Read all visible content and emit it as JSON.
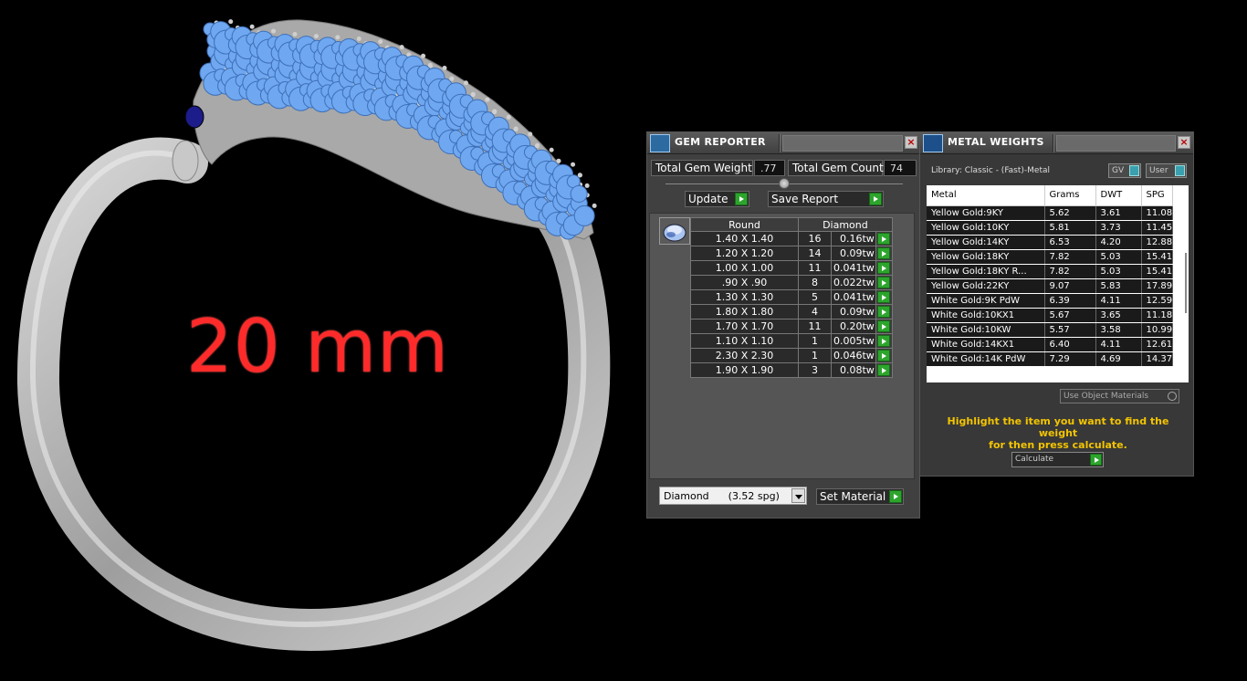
{
  "viewport": {
    "dimension_label": "20 mm",
    "colors": {
      "background": "#000000",
      "ring_metal": "#a8a8a8",
      "gems": "#6fa8f0",
      "dimension_text": "#ff2b2b"
    }
  },
  "gem_reporter": {
    "title": "GEM REPORTER",
    "total_gem_weight_label": "Total Gem Weight",
    "total_gem_weight_value": ".77",
    "total_gem_count_label": "Total Gem Count",
    "total_gem_count_value": "74",
    "update_label": "Update",
    "save_report_label": "Save Report",
    "table": {
      "shape_header": "Round",
      "material_header": "Diamond",
      "rows": [
        {
          "size": "1.40 X 1.40",
          "count": "16",
          "tw": "0.16tw"
        },
        {
          "size": "1.20 X 1.20",
          "count": "14",
          "tw": "0.09tw"
        },
        {
          "size": "1.00 X 1.00",
          "count": "11",
          "tw": "0.041tw"
        },
        {
          "size": ".90 X .90",
          "count": "8",
          "tw": "0.022tw"
        },
        {
          "size": "1.30 X 1.30",
          "count": "5",
          "tw": "0.041tw"
        },
        {
          "size": "1.80 X 1.80",
          "count": "4",
          "tw": "0.09tw"
        },
        {
          "size": "1.70 X 1.70",
          "count": "11",
          "tw": "0.20tw"
        },
        {
          "size": "1.10 X 1.10",
          "count": "1",
          "tw": "0.005tw"
        },
        {
          "size": "2.30 X 2.30",
          "count": "1",
          "tw": "0.046tw"
        },
        {
          "size": "1.90 X 1.90",
          "count": "3",
          "tw": "0.08tw"
        }
      ]
    },
    "material_select_value": "Diamond      (3.52 spg)",
    "set_material_label": "Set Material",
    "close_icon": "close-icon"
  },
  "metal_weights": {
    "title": "METAL WEIGHTS",
    "library_label": "Library: Classic - (Fast)-Metal",
    "gv_label": "GV",
    "user_label": "User",
    "columns": [
      "Metal",
      "Grams",
      "DWT",
      "SPG"
    ],
    "rows": [
      {
        "metal": "Yellow Gold:9KY",
        "grams": "5.62",
        "dwt": "3.61",
        "spg": "11.08"
      },
      {
        "metal": "Yellow Gold:10KY",
        "grams": "5.81",
        "dwt": "3.73",
        "spg": "11.45"
      },
      {
        "metal": "Yellow Gold:14KY",
        "grams": "6.53",
        "dwt": "4.20",
        "spg": "12.88"
      },
      {
        "metal": "Yellow Gold:18KY",
        "grams": "7.82",
        "dwt": "5.03",
        "spg": "15.41"
      },
      {
        "metal": "Yellow Gold:18KY R...",
        "grams": "7.82",
        "dwt": "5.03",
        "spg": "15.41"
      },
      {
        "metal": "Yellow Gold:22KY",
        "grams": "9.07",
        "dwt": "5.83",
        "spg": "17.89"
      },
      {
        "metal": "White Gold:9K PdW",
        "grams": "6.39",
        "dwt": "4.11",
        "spg": "12.59"
      },
      {
        "metal": "White Gold:10KX1",
        "grams": "5.67",
        "dwt": "3.65",
        "spg": "11.18"
      },
      {
        "metal": "White Gold:10KW",
        "grams": "5.57",
        "dwt": "3.58",
        "spg": "10.99"
      },
      {
        "metal": "White Gold:14KX1",
        "grams": "6.40",
        "dwt": "4.11",
        "spg": "12.61"
      },
      {
        "metal": "White Gold:14K PdW",
        "grams": "7.29",
        "dwt": "4.69",
        "spg": "14.37"
      }
    ],
    "use_object_materials_label": "Use Object Materials",
    "hint_text_line1": "Highlight the item you want to find the weight",
    "hint_text_line2": "for then press calculate.",
    "calculate_label": "Calculate",
    "close_icon": "close-icon"
  }
}
